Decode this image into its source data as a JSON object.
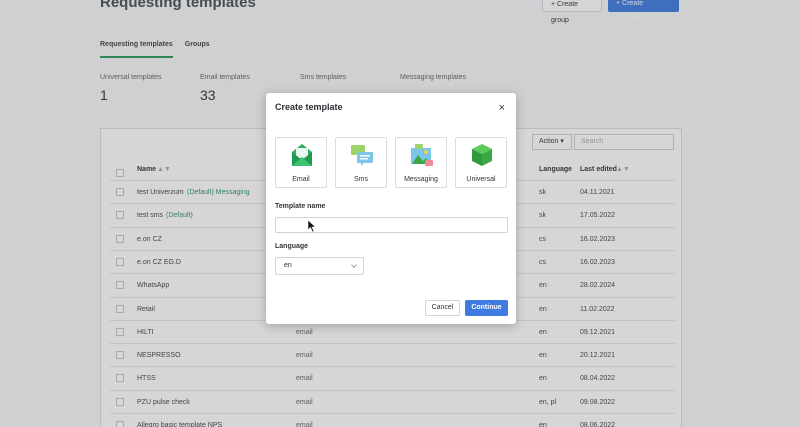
{
  "page": {
    "title": "Requesting templates",
    "create_group_label": "+ Create group",
    "create_template_label": "+ Create template",
    "tabs": [
      {
        "label": "Requesting templates"
      },
      {
        "label": "Groups"
      }
    ],
    "stats": [
      {
        "label": "Universal templates",
        "value": "1"
      },
      {
        "label": "Email templates",
        "value": "33"
      },
      {
        "label": "Sms templates",
        "value": ""
      },
      {
        "label": "Messaging templates",
        "value": ""
      }
    ],
    "toolbar": {
      "action_label": "Action ▾",
      "search_placeholder": "Search"
    },
    "columns": {
      "name": "Name",
      "language": "Language",
      "last_edited": "Last edited"
    },
    "rows": [
      {
        "name": "test Univerzum",
        "tag": "(Default) Messaging",
        "type": "",
        "lang": "sk",
        "date": "04.11.2021"
      },
      {
        "name": "test sms",
        "tag": "(Default)",
        "type": "",
        "lang": "sk",
        "date": "17.05.2022"
      },
      {
        "name": "e.on CZ",
        "tag": "",
        "type": "",
        "lang": "cs",
        "date": "16.02.2023"
      },
      {
        "name": "e.on CZ EG.D",
        "tag": "",
        "type": "",
        "lang": "cs",
        "date": "16.02.2023"
      },
      {
        "name": "WhatsApp",
        "tag": "",
        "type": "",
        "lang": "en",
        "date": "28.02.2024"
      },
      {
        "name": "Retail",
        "tag": "",
        "type": "",
        "lang": "en",
        "date": "11.02.2022"
      },
      {
        "name": "HILTI",
        "tag": "",
        "type": "email",
        "lang": "en",
        "date": "09.12.2021"
      },
      {
        "name": "NESPRESSO",
        "tag": "",
        "type": "email",
        "lang": "en",
        "date": "20.12.2021"
      },
      {
        "name": "HTSS",
        "tag": "",
        "type": "email",
        "lang": "en",
        "date": "08.04.2022"
      },
      {
        "name": "PZU pulse check",
        "tag": "",
        "type": "email",
        "lang": "en, pl",
        "date": "09.08.2022"
      },
      {
        "name": "Allegro basic template NPS",
        "tag": "",
        "type": "email",
        "lang": "en",
        "date": "08.06.2022"
      }
    ]
  },
  "modal": {
    "title": "Create template",
    "close_glyph": "×",
    "types": [
      {
        "label": "Email",
        "icon": "envelope-icon",
        "color": "#2fae62"
      },
      {
        "label": "Sms",
        "icon": "chat-bubbles-icon",
        "color": "#9ed36a"
      },
      {
        "label": "Messaging",
        "icon": "messaging-image-icon",
        "color": "#7cc6e8"
      },
      {
        "label": "Universal",
        "icon": "cube-icon",
        "color": "#3aa845"
      }
    ],
    "template_name_label": "Template name",
    "template_name_value": "",
    "language_label": "Language",
    "language_value": "en",
    "cancel_label": "Cancel",
    "continue_label": "Continue"
  },
  "colors": {
    "accent": "#3d7be0",
    "tab_active": "#2f9a5b"
  }
}
